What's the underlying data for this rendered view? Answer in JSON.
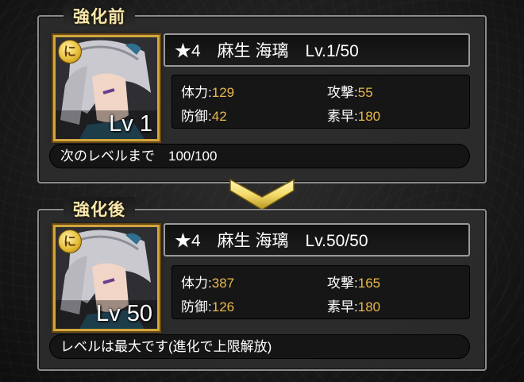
{
  "colors": {
    "stat_value": "#e8b84a",
    "frame_gold": "#d1a63e",
    "title_gold": "#f6e7ad",
    "arrow_gold": "#f3dc6b"
  },
  "before": {
    "title": "強化前",
    "portrait": {
      "attr_badge": "に",
      "level": "Lv 1",
      "icon": "character-portrait"
    },
    "name_line": "★4　麻生 海璃　Lv.1/50",
    "stats": {
      "hp": {
        "label": "体力:",
        "value": "129"
      },
      "atk": {
        "label": "攻撃:",
        "value": "55"
      },
      "def": {
        "label": "防御:",
        "value": "42"
      },
      "spd": {
        "label": "素早:",
        "value": "180"
      }
    },
    "message": "次のレベルまで　100/100"
  },
  "arrow_icon": "chevron-down-icon",
  "after": {
    "title": "強化後",
    "portrait": {
      "attr_badge": "に",
      "level": "Lv 50",
      "icon": "character-portrait"
    },
    "name_line": "★4　麻生 海璃　Lv.50/50",
    "stats": {
      "hp": {
        "label": "体力:",
        "value": "387"
      },
      "atk": {
        "label": "攻撃:",
        "value": "165"
      },
      "def": {
        "label": "防御:",
        "value": "126"
      },
      "spd": {
        "label": "素早:",
        "value": "180"
      }
    },
    "message": "レベルは最大です(進化で上限解放)"
  }
}
